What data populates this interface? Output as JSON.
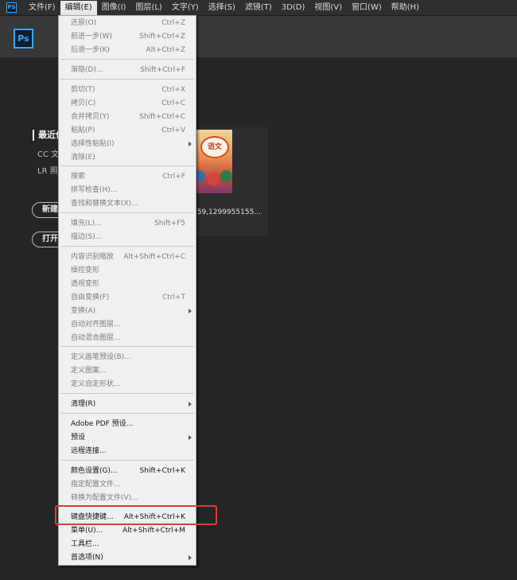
{
  "menubar": {
    "app_icon": "PS",
    "items": [
      {
        "label": "文件(F)",
        "active": false
      },
      {
        "label": "编辑(E)",
        "active": true
      },
      {
        "label": "图像(I)",
        "active": false
      },
      {
        "label": "图层(L)",
        "active": false
      },
      {
        "label": "文字(Y)",
        "active": false
      },
      {
        "label": "选择(S)",
        "active": false
      },
      {
        "label": "滤镜(T)",
        "active": false
      },
      {
        "label": "3D(D)",
        "active": false
      },
      {
        "label": "视图(V)",
        "active": false
      },
      {
        "label": "窗口(W)",
        "active": false
      },
      {
        "label": "帮助(H)",
        "active": false
      }
    ]
  },
  "home": {
    "logo": "Ps",
    "recent_title": "最近使",
    "sub_cc": "CC 文",
    "sub_lr": "LR 照",
    "new_button": "新建",
    "open_button": "打开",
    "thumb_text": "语文",
    "thumb_name": "759,1299955155..."
  },
  "edit_menu": {
    "highlight_color": "#e53935",
    "items": [
      {
        "label": "还原(O)",
        "shortcut": "Ctrl+Z",
        "enabled": false,
        "submenu": false
      },
      {
        "label": "前进一步(W)",
        "shortcut": "Shift+Ctrl+Z",
        "enabled": false,
        "submenu": false
      },
      {
        "label": "后退一步(K)",
        "shortcut": "Alt+Ctrl+Z",
        "enabled": false,
        "submenu": false
      },
      {
        "separator": true
      },
      {
        "label": "渐隐(D)...",
        "shortcut": "Shift+Ctrl+F",
        "enabled": false,
        "submenu": false
      },
      {
        "separator": true
      },
      {
        "label": "剪切(T)",
        "shortcut": "Ctrl+X",
        "enabled": false,
        "submenu": false
      },
      {
        "label": "拷贝(C)",
        "shortcut": "Ctrl+C",
        "enabled": false,
        "submenu": false
      },
      {
        "label": "合并拷贝(Y)",
        "shortcut": "Shift+Ctrl+C",
        "enabled": false,
        "submenu": false
      },
      {
        "label": "粘贴(P)",
        "shortcut": "Ctrl+V",
        "enabled": false,
        "submenu": false
      },
      {
        "label": "选择性粘贴(I)",
        "shortcut": "",
        "enabled": false,
        "submenu": true
      },
      {
        "label": "清除(E)",
        "shortcut": "",
        "enabled": false,
        "submenu": false
      },
      {
        "separator": true
      },
      {
        "label": "搜索",
        "shortcut": "Ctrl+F",
        "enabled": false,
        "submenu": false
      },
      {
        "label": "拼写检查(H)...",
        "shortcut": "",
        "enabled": false,
        "submenu": false
      },
      {
        "label": "查找和替换文本(X)...",
        "shortcut": "",
        "enabled": false,
        "submenu": false
      },
      {
        "separator": true
      },
      {
        "label": "填充(L)...",
        "shortcut": "Shift+F5",
        "enabled": false,
        "submenu": false
      },
      {
        "label": "描边(S)...",
        "shortcut": "",
        "enabled": false,
        "submenu": false
      },
      {
        "separator": true
      },
      {
        "label": "内容识别缩放",
        "shortcut": "Alt+Shift+Ctrl+C",
        "enabled": false,
        "submenu": false
      },
      {
        "label": "操控变形",
        "shortcut": "",
        "enabled": false,
        "submenu": false
      },
      {
        "label": "透视变形",
        "shortcut": "",
        "enabled": false,
        "submenu": false
      },
      {
        "label": "自由变换(F)",
        "shortcut": "Ctrl+T",
        "enabled": false,
        "submenu": false
      },
      {
        "label": "变换(A)",
        "shortcut": "",
        "enabled": false,
        "submenu": true
      },
      {
        "label": "自动对齐图层...",
        "shortcut": "",
        "enabled": false,
        "submenu": false
      },
      {
        "label": "自动混合图层...",
        "shortcut": "",
        "enabled": false,
        "submenu": false
      },
      {
        "separator": true
      },
      {
        "label": "定义画笔预设(B)...",
        "shortcut": "",
        "enabled": false,
        "submenu": false
      },
      {
        "label": "定义图案...",
        "shortcut": "",
        "enabled": false,
        "submenu": false
      },
      {
        "label": "定义自定形状...",
        "shortcut": "",
        "enabled": false,
        "submenu": false
      },
      {
        "separator": true
      },
      {
        "label": "清理(R)",
        "shortcut": "",
        "enabled": true,
        "submenu": true
      },
      {
        "separator": true
      },
      {
        "label": "Adobe PDF 预设...",
        "shortcut": "",
        "enabled": true,
        "submenu": false
      },
      {
        "label": "预设",
        "shortcut": "",
        "enabled": true,
        "submenu": true
      },
      {
        "label": "远程连接...",
        "shortcut": "",
        "enabled": true,
        "submenu": false
      },
      {
        "separator": true
      },
      {
        "label": "颜色设置(G)...",
        "shortcut": "Shift+Ctrl+K",
        "enabled": true,
        "submenu": false
      },
      {
        "label": "指定配置文件...",
        "shortcut": "",
        "enabled": false,
        "submenu": false
      },
      {
        "label": "转换为配置文件(V)...",
        "shortcut": "",
        "enabled": false,
        "submenu": false
      },
      {
        "separator": true
      },
      {
        "label": "键盘快捷键...",
        "shortcut": "Alt+Shift+Ctrl+K",
        "enabled": true,
        "submenu": false,
        "highlighted": true
      },
      {
        "label": "菜单(U)...",
        "shortcut": "Alt+Shift+Ctrl+M",
        "enabled": true,
        "submenu": false
      },
      {
        "label": "工具栏...",
        "shortcut": "",
        "enabled": true,
        "submenu": false
      },
      {
        "label": "首选项(N)",
        "shortcut": "",
        "enabled": true,
        "submenu": true
      }
    ]
  }
}
